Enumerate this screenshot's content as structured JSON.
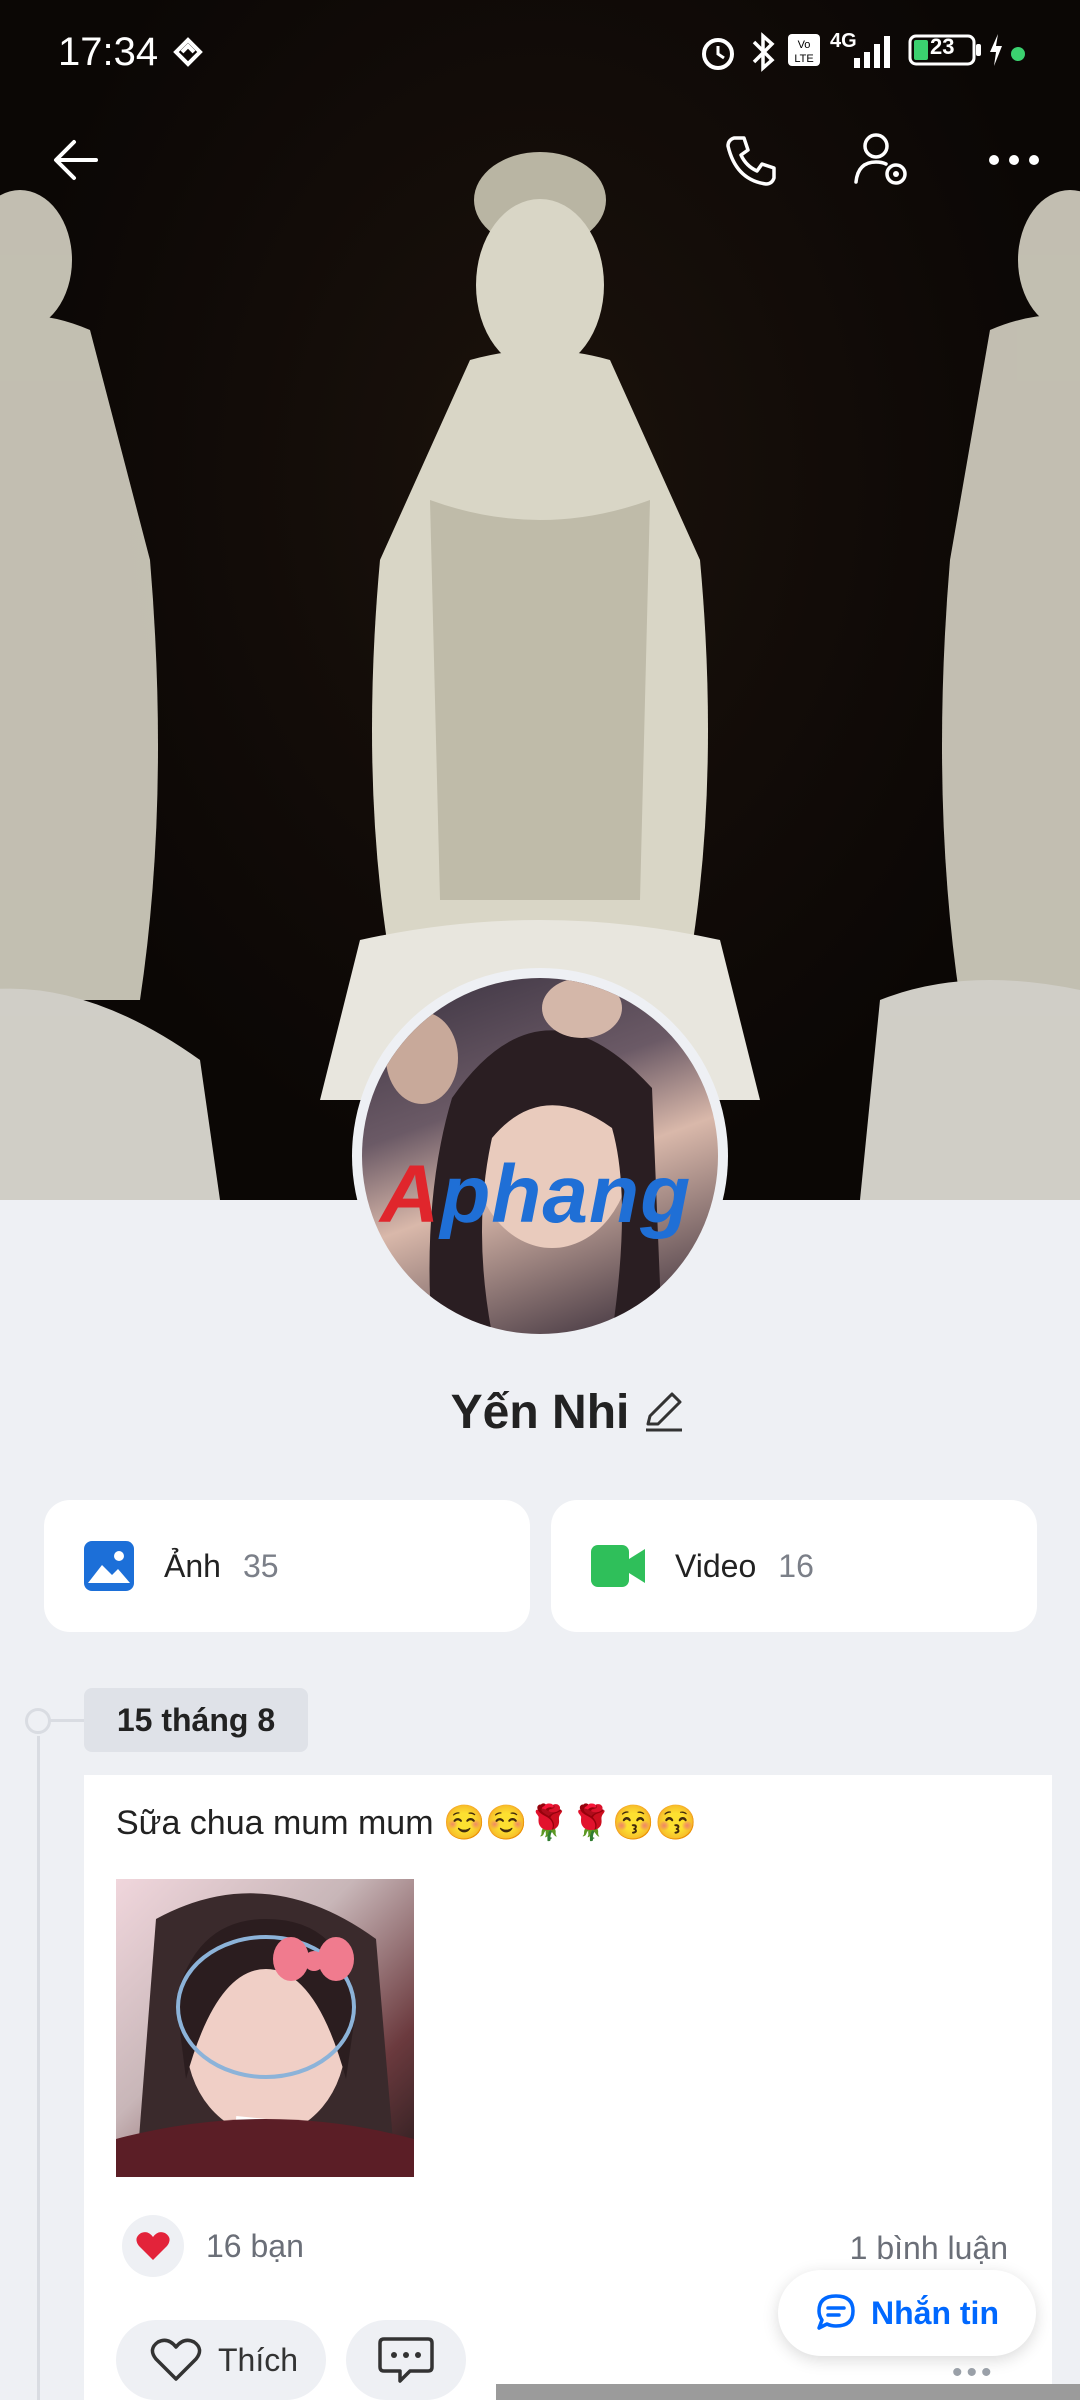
{
  "status_bar": {
    "time": "17:34",
    "battery": "23",
    "network": "4G"
  },
  "nav": {
    "back_icon": "arrow-left-icon",
    "call_icon": "phone-icon",
    "settings_icon": "user-settings-icon",
    "more_icon": "more-horizontal-icon"
  },
  "profile": {
    "name": "Yến Nhi",
    "avatar_watermark": "Aphang"
  },
  "media": {
    "photos_label": "Ảnh",
    "photos_count": "35",
    "videos_label": "Video",
    "videos_count": "16"
  },
  "post": {
    "date": "15 tháng 8",
    "text": "Sữa chua mum mum ☺️☺️🌹🌹😚😚",
    "likes": "16 bạn",
    "comments": "1 bình luận",
    "like_label": "Thích"
  },
  "fab": {
    "message_label": "Nhắn tin"
  },
  "colors": {
    "accent": "#0068ff",
    "photo_icon": "#1c6fd8",
    "video_icon": "#2fbf5a",
    "background": "#eef0f4"
  }
}
